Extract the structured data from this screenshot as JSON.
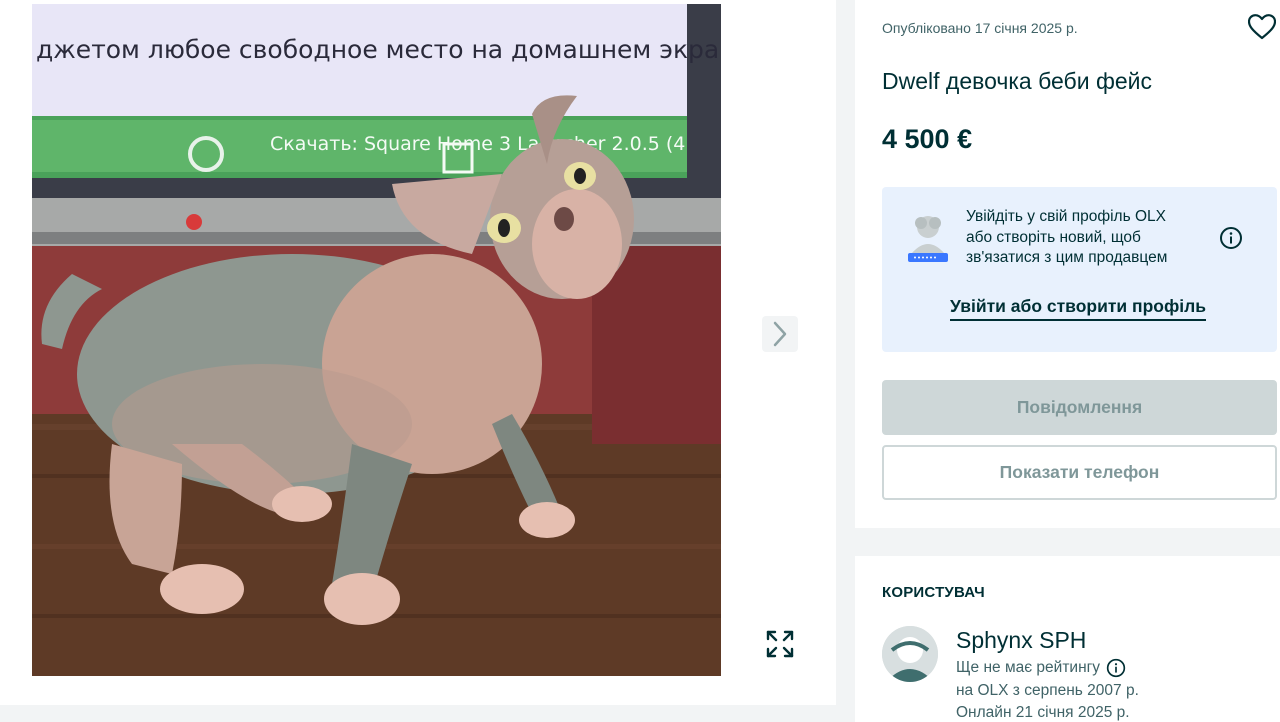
{
  "gallery": {
    "photo_screen_text": "джетом любое свободное место на домашнем экране, з",
    "photo_download_text": "Скачать: Square Home 3 Launcher 2.0.5 (4"
  },
  "listing": {
    "published": "Опубліковано 17 січня 2025 р.",
    "title": "Dwelf девочка беби фейс",
    "price": "4 500 €"
  },
  "login_prompt": {
    "text": "Увійдіть у свій профіль OLX або створіть новий, щоб зв'язатися з цим продавцем",
    "link": "Увійти або створити профіль"
  },
  "actions": {
    "message": "Повідомлення",
    "phone": "Показати телефон"
  },
  "user": {
    "heading": "КОРИСТУВАЧ",
    "name": "Sphynx SPH",
    "rating": "Ще не має рейтингу",
    "since": "на OLX з серпень 2007 р.",
    "online": "Онлайн 21 січня 2025 р."
  },
  "colors": {
    "brand_dark": "#002f34",
    "info_bg": "#e8f1fd",
    "disabled_btn": "#ced7d8"
  },
  "icons": {
    "favorite": "heart-icon",
    "next": "chevron-right-icon",
    "expand": "expand-icon",
    "info": "info-icon"
  }
}
